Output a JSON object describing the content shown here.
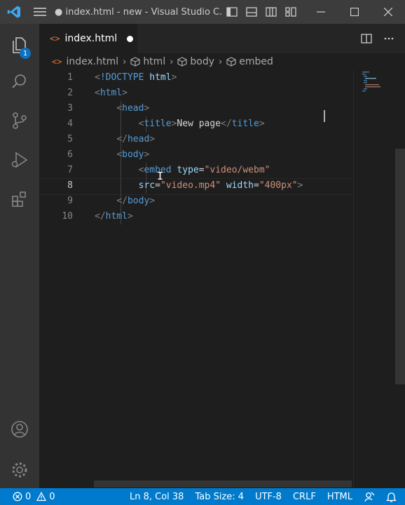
{
  "window": {
    "title": "● index.html - new - Visual Studio C...",
    "controls": [
      "minimize",
      "maximize",
      "close"
    ]
  },
  "activity_bar": {
    "items": [
      {
        "name": "explorer",
        "icon": "files-icon",
        "badge": "1"
      },
      {
        "name": "search",
        "icon": "search-icon"
      },
      {
        "name": "source-control",
        "icon": "source-control-icon"
      },
      {
        "name": "run-debug",
        "icon": "run-debug-icon"
      },
      {
        "name": "extensions",
        "icon": "extensions-icon"
      }
    ],
    "bottom": [
      {
        "name": "accounts",
        "icon": "account-icon"
      },
      {
        "name": "manage",
        "icon": "gear-icon"
      }
    ]
  },
  "tab": {
    "icon_text": "<>",
    "label": "index.html",
    "dirty": true
  },
  "breadcrumb": {
    "file_icon_text": "<>",
    "items": [
      "index.html",
      "html",
      "body",
      "embed"
    ]
  },
  "editor": {
    "lines": [
      {
        "n": "1",
        "tokens": [
          [
            "punc",
            "<"
          ],
          [
            "tag",
            "!DOCTYPE"
          ],
          [
            "text",
            " "
          ],
          [
            "attr",
            "html"
          ],
          [
            "punc",
            ">"
          ]
        ]
      },
      {
        "n": "2",
        "tokens": [
          [
            "punc",
            "<"
          ],
          [
            "tag",
            "html"
          ],
          [
            "punc",
            ">"
          ]
        ]
      },
      {
        "n": "3",
        "tokens": [
          [
            "text",
            "    "
          ],
          [
            "punc",
            "<"
          ],
          [
            "tag",
            "head"
          ],
          [
            "punc",
            ">"
          ]
        ]
      },
      {
        "n": "4",
        "tokens": [
          [
            "text",
            "        "
          ],
          [
            "punc",
            "<"
          ],
          [
            "tag",
            "title"
          ],
          [
            "punc",
            ">"
          ],
          [
            "text",
            "New page"
          ],
          [
            "punc",
            "</"
          ],
          [
            "tag",
            "title"
          ],
          [
            "punc",
            ">"
          ]
        ]
      },
      {
        "n": "5",
        "tokens": [
          [
            "text",
            "    "
          ],
          [
            "punc",
            "</"
          ],
          [
            "tag",
            "head"
          ],
          [
            "punc",
            ">"
          ]
        ]
      },
      {
        "n": "6",
        "tokens": [
          [
            "text",
            "    "
          ],
          [
            "punc",
            "<"
          ],
          [
            "tag",
            "body"
          ],
          [
            "punc",
            ">"
          ]
        ]
      },
      {
        "n": "7",
        "tokens": [
          [
            "text",
            "        "
          ],
          [
            "punc",
            "<"
          ],
          [
            "tag",
            "embed"
          ],
          [
            "text",
            " "
          ],
          [
            "attr",
            "type"
          ],
          [
            "text",
            "="
          ],
          [
            "str",
            "\"video/webm\""
          ]
        ]
      },
      {
        "n": "8",
        "tokens": [
          [
            "text",
            "        "
          ],
          [
            "attr",
            "src"
          ],
          [
            "text",
            "="
          ],
          [
            "str",
            "\"video.mp4\""
          ],
          [
            "text",
            " "
          ],
          [
            "attr",
            "width"
          ],
          [
            "text",
            "="
          ],
          [
            "str",
            "\"400px\""
          ],
          [
            "punc",
            ">"
          ]
        ]
      },
      {
        "n": "9",
        "tokens": [
          [
            "text",
            "    "
          ],
          [
            "punc",
            "</"
          ],
          [
            "tag",
            "body"
          ],
          [
            "punc",
            ">"
          ]
        ]
      },
      {
        "n": "10",
        "tokens": [
          [
            "punc",
            "</"
          ],
          [
            "tag",
            "html"
          ],
          [
            "punc",
            ">"
          ]
        ]
      }
    ],
    "active_line": "8"
  },
  "status_bar": {
    "errors": "0",
    "warnings": "0",
    "cursor": "Ln 8, Col 38",
    "tab_size": "Tab Size: 4",
    "encoding": "UTF-8",
    "eol": "CRLF",
    "language": "HTML"
  },
  "colors": {
    "accent": "#007acc",
    "titlebar": "#3c3c3c",
    "activity": "#333333",
    "editor_bg": "#1e1e1e",
    "tag": "#569cd6",
    "attr": "#9cdcfe",
    "string": "#ce9178"
  }
}
